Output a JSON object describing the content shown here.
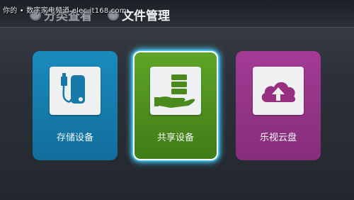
{
  "watermark": {
    "text": "你的 • 数字家电频道 elec.it168.com"
  },
  "header": {
    "tabs": [
      {
        "label": "分类查看",
        "icon": "category-icon"
      },
      {
        "label": "文件管理",
        "icon": "file-manage-icon"
      }
    ]
  },
  "cards": [
    {
      "label": "存储设备",
      "icon": "usb-storage-icon",
      "color": "#1a8bbd"
    },
    {
      "label": "共享设备",
      "icon": "share-device-icon",
      "color": "#5fa427"
    },
    {
      "label": "乐视云盘",
      "icon": "cloud-upload-icon",
      "color": "#a33b95"
    }
  ]
}
